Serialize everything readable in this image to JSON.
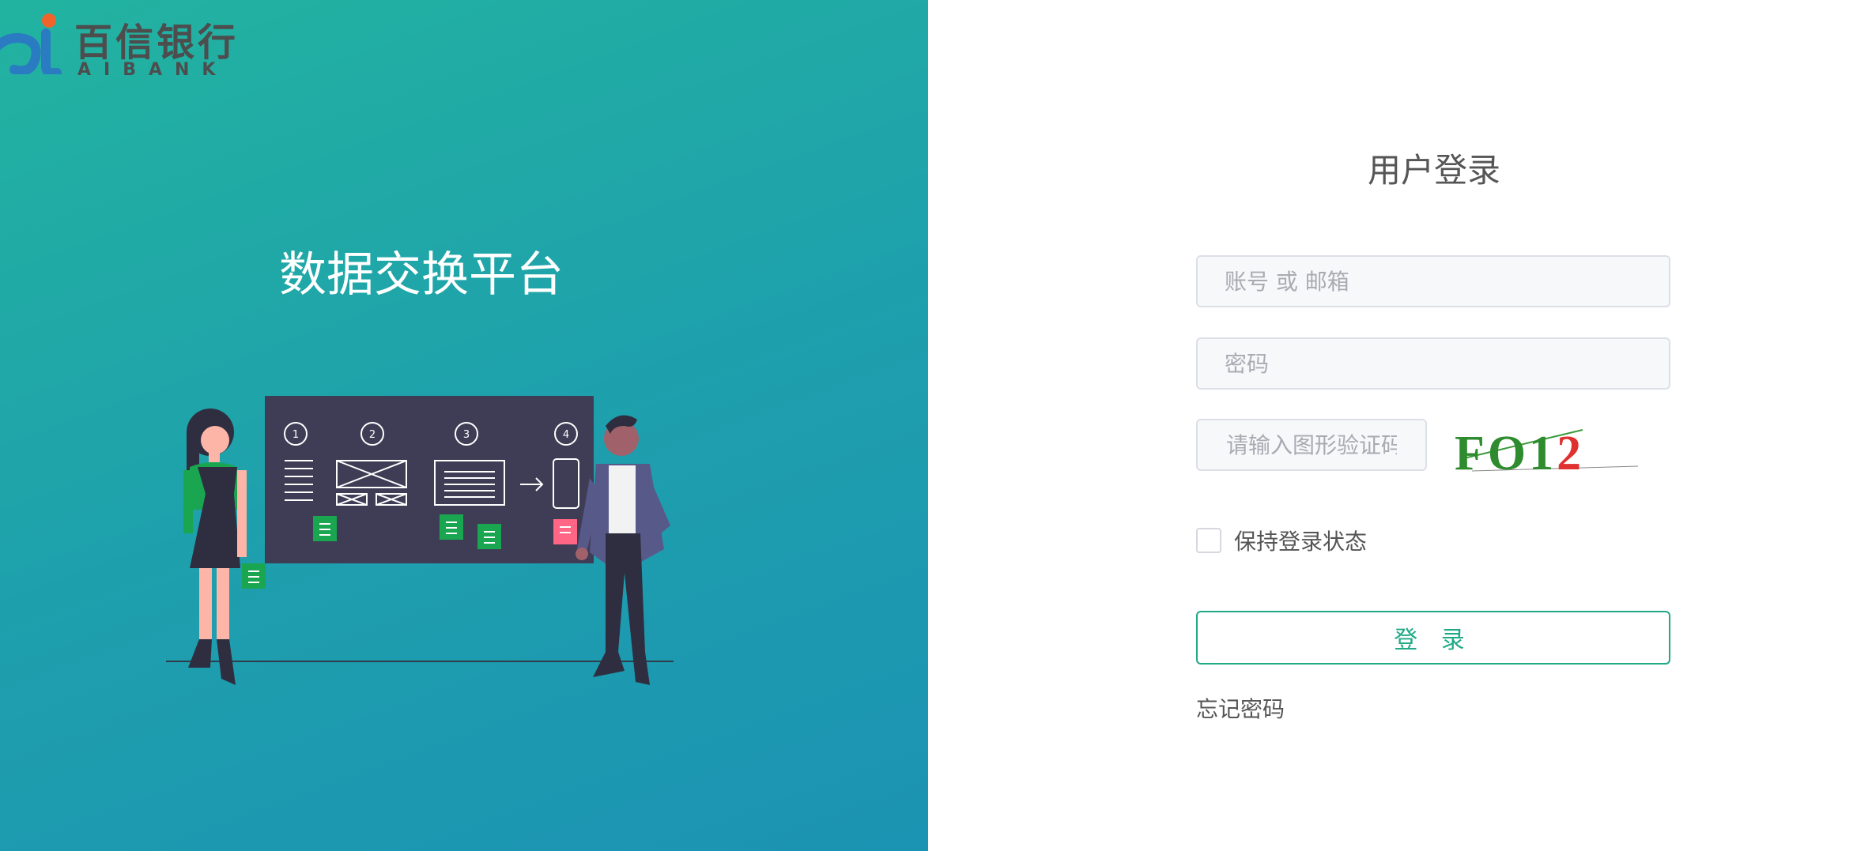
{
  "logo": {
    "cn_text": "百信银行",
    "en_text": "AIBANK"
  },
  "platform": {
    "title": "数据交换平台"
  },
  "illustration": {
    "steps": [
      "1",
      "2",
      "3",
      "4"
    ]
  },
  "login": {
    "title": "用户登录",
    "username_placeholder": "账号 或 邮箱",
    "password_placeholder": "密码",
    "captcha_placeholder": "请输入图形验证码",
    "captcha_text": "FO12",
    "remember_label": "保持登录状态",
    "submit_label": "登 录",
    "forgot_label": "忘记密码"
  },
  "colors": {
    "accent": "#20a987",
    "gradient_start": "#22b3a0",
    "gradient_end": "#1b93b3",
    "logo_dot": "#f0642b",
    "logo_blue": "#2a7bc2"
  }
}
